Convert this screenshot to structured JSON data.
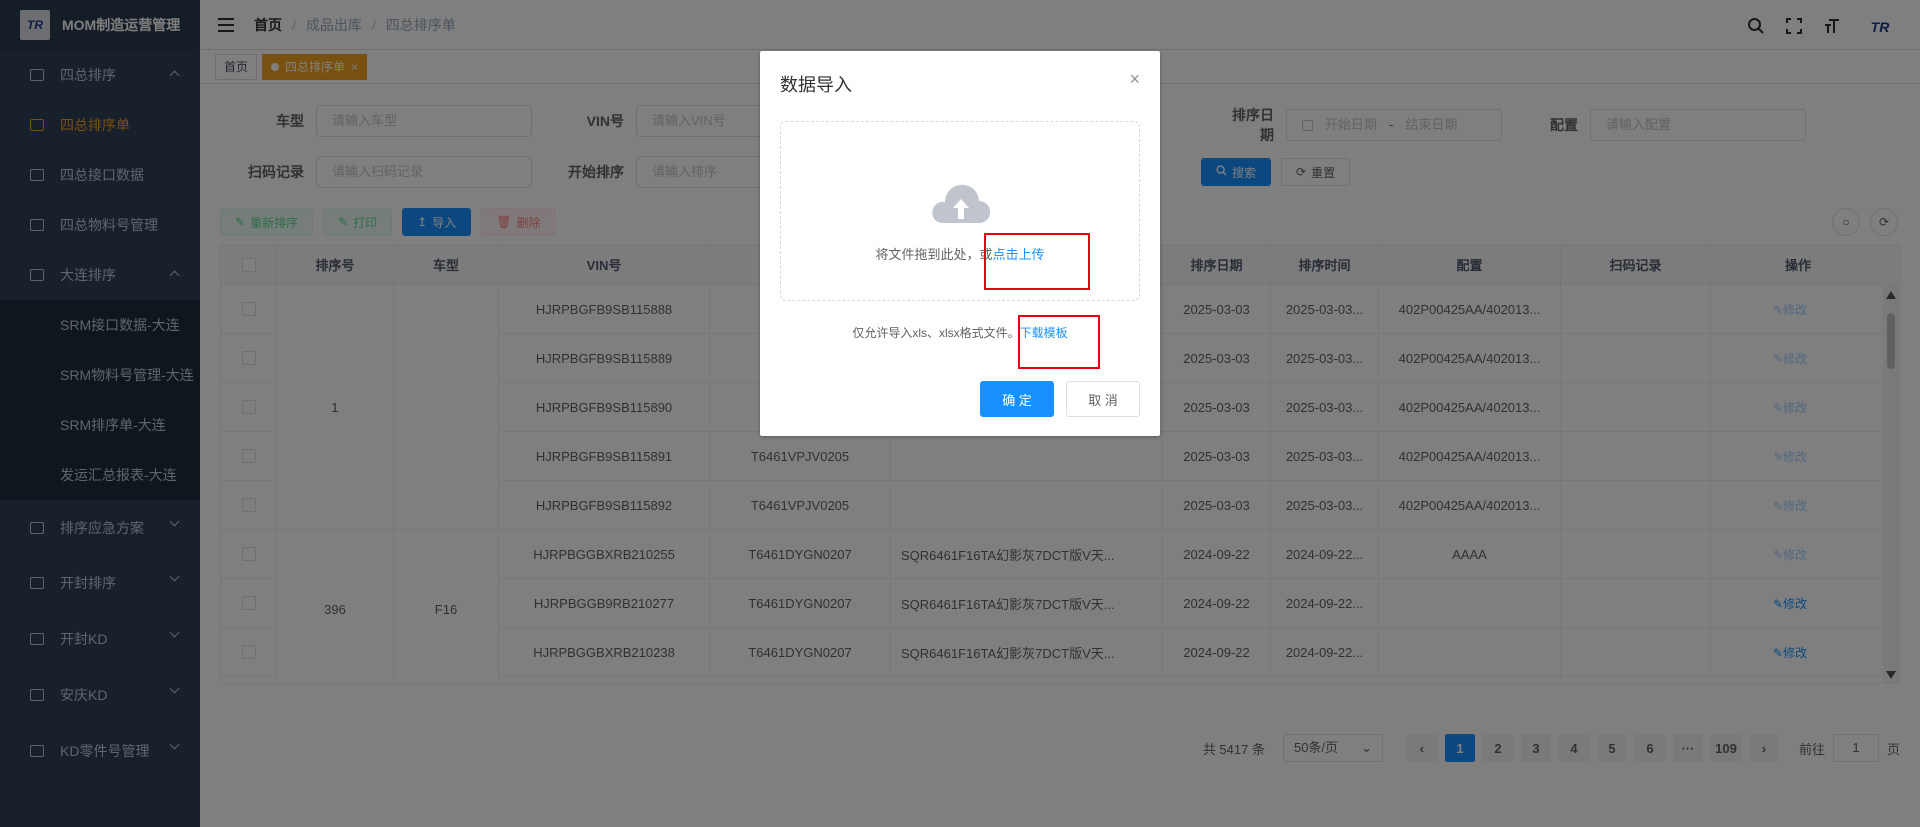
{
  "app": {
    "title": "MOM制造运营管理",
    "logo_text": "TR"
  },
  "sidebar": {
    "items": [
      {
        "label": "四总排序",
        "expanded": true
      },
      {
        "label": "四总排序单",
        "active": true
      },
      {
        "label": "四总接口数据"
      },
      {
        "label": "四总物料号管理"
      },
      {
        "label": "大连排序",
        "expanded": true
      },
      {
        "label": "SRM接口数据-大连"
      },
      {
        "label": "SRM物料号管理-大连"
      },
      {
        "label": "SRM排序单-大连"
      },
      {
        "label": "发运汇总报表-大连"
      },
      {
        "label": "排序应急方案"
      },
      {
        "label": "开封排序"
      },
      {
        "label": "开封KD"
      },
      {
        "label": "安庆KD"
      },
      {
        "label": "KD零件号管理"
      }
    ]
  },
  "header": {
    "breadcrumb": [
      "首页",
      "成品出库",
      "四总排序单"
    ],
    "separator": "/",
    "avatar_text": "TR"
  },
  "tags": {
    "home": "首页",
    "current": "四总排序单",
    "close": "×"
  },
  "filters": {
    "car_type": {
      "label": "车型",
      "placeholder": "请输入车型"
    },
    "vin": {
      "label": "VIN号",
      "placeholder": "请输入VIN号"
    },
    "sort_date": {
      "label": "排序日期",
      "start": "开始日期",
      "sep": "-",
      "end": "结束日期"
    },
    "config": {
      "label": "配置",
      "placeholder": "请输入配置"
    },
    "scan": {
      "label": "扫码记录",
      "placeholder": "请输入扫码记录"
    },
    "start_sort": {
      "label": "开始排序",
      "placeholder": "请输入排序"
    },
    "search_btn": "搜索",
    "reset_btn": "重置"
  },
  "toolbar": {
    "resort": "重新排序",
    "print": "打印",
    "import": "导入",
    "delete": "删除"
  },
  "table": {
    "headers": [
      "排序号",
      "车型",
      "VIN号",
      "",
      "",
      "排序日期",
      "排序时间",
      "配置",
      "扫码记录",
      "操作"
    ],
    "rows": [
      {
        "vin": "HJRPBGFB9SB115888",
        "part": "T6",
        "desc": "",
        "date": "2025-03-03",
        "time": "2025-03-03...",
        "config": "402P00425AA/402013...",
        "op": "修改"
      },
      {
        "vin": "HJRPBGFB9SB115889",
        "part": "T6",
        "desc": "",
        "date": "2025-03-03",
        "time": "2025-03-03...",
        "config": "402P00425AA/402013...",
        "op": "修改"
      },
      {
        "vin": "HJRPBGFB9SB115890",
        "part": "T6",
        "desc": "",
        "date": "2025-03-03",
        "time": "2025-03-03...",
        "config": "402P00425AA/402013...",
        "op": "修改"
      },
      {
        "vin": "HJRPBGFB9SB115891",
        "part": "T6461VPJV0205",
        "desc": "",
        "date": "2025-03-03",
        "time": "2025-03-03...",
        "config": "402P00425AA/402013...",
        "op": "修改"
      },
      {
        "vin": "HJRPBGFB9SB115892",
        "part": "T6461VPJV0205",
        "desc": "",
        "date": "2025-03-03",
        "time": "2025-03-03...",
        "config": "402P00425AA/402013...",
        "op": "修改"
      },
      {
        "vin": "HJRPBGGBXRB210255",
        "part": "T6461DYGN0207",
        "desc": "SQR6461F16TA幻影灰7DCT版V天...",
        "date": "2024-09-22",
        "time": "2024-09-22...",
        "config": "AAAA",
        "op": "修改"
      },
      {
        "vin": "HJRPBGGB9RB210277",
        "part": "T6461DYGN0207",
        "desc": "SQR6461F16TA幻影灰7DCT版V天...",
        "date": "2024-09-22",
        "time": "2024-09-22...",
        "config": "",
        "op": "修改"
      },
      {
        "vin": "HJRPBGGBXRB210238",
        "part": "T6461DYGN0207",
        "desc": "SQR6461F16TA幻影灰7DCT版V天...",
        "date": "2024-09-22",
        "time": "2024-09-22...",
        "config": "",
        "op": "修改"
      }
    ],
    "merged_group1": {
      "sort_no": "1"
    },
    "merged_group2": {
      "sort_no": "396",
      "car_type": "F16"
    }
  },
  "pagination": {
    "total": "共 5417 条",
    "page_size": "50条/页",
    "pages": [
      "1",
      "2",
      "3",
      "4",
      "5",
      "6",
      "···",
      "109"
    ],
    "goto_label": "前往",
    "goto_value": "1",
    "goto_suffix": "页"
  },
  "dialog": {
    "title": "数据导入",
    "close": "×",
    "upload_text": "将文件拖到此处，或",
    "upload_link": "点击上传",
    "tip_text": "仅允许导入xls、xlsx格式文件。",
    "tip_link": "下载模板",
    "ok": "确 定",
    "cancel": "取 消"
  }
}
